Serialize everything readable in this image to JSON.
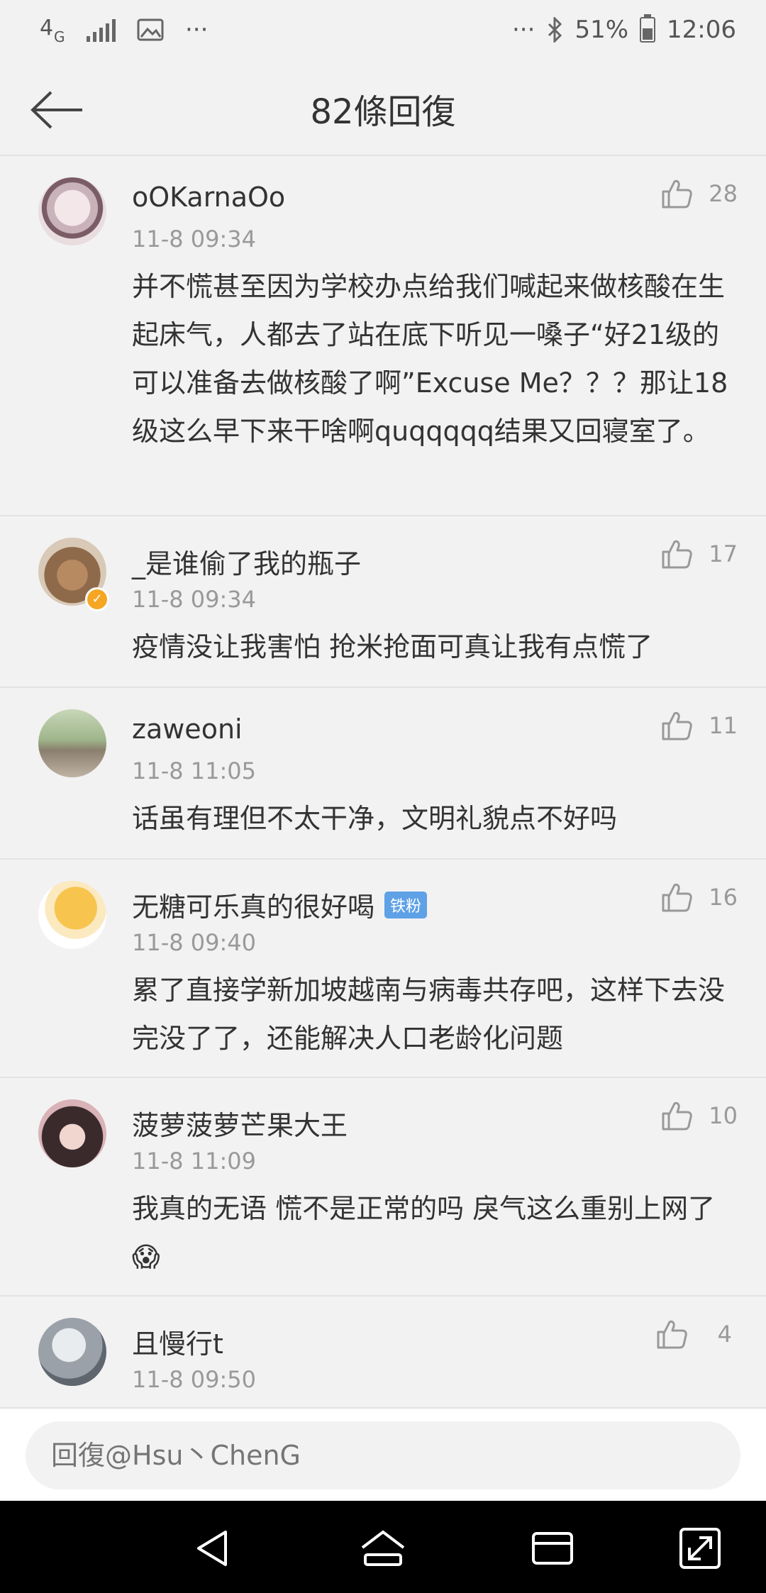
{
  "status_bar": {
    "network": "4G",
    "dots": "···",
    "battery": "51%",
    "time": "12:06"
  },
  "header": {
    "title": "82條回復"
  },
  "comments": [
    {
      "username": "oOKarnaOo",
      "time": "11-8 09:34",
      "likes": "28",
      "text": "并不慌甚至因为学校办点给我们喊起来做核酸在生起床气，人都去了站在底下听见一嗓子“好21级的可以准备去做核酸了啊”Excuse Me？？？那让18级这么早下来干啥啊quqqqqq结果又回寝室了。"
    },
    {
      "username": "_是谁偷了我的瓶子",
      "time": "11-8 09:34",
      "likes": "17",
      "verified": true,
      "text": "疫情没让我害怕 抢米抢面可真让我有点慌了"
    },
    {
      "username": "zaweoni",
      "time": "11-8 11:05",
      "likes": "11",
      "text": "话虽有理但不太干净，文明礼貌点不好吗"
    },
    {
      "username": "无糖可乐真的很好喝",
      "badge": "铁粉",
      "time": "11-8 09:40",
      "likes": "16",
      "text": "累了直接学新加坡越南与病毒共存吧，这样下去没完没了了，还能解决人口老龄化问题"
    },
    {
      "username": "菠萝菠萝芒果大王",
      "time": "11-8 11:09",
      "likes": "10",
      "text": "我真的无语 慌不是正常的吗 戾气这么重别上网了😱"
    },
    {
      "username": "且慢行t",
      "time": "11-8 09:50",
      "likes": "4",
      "text": ""
    }
  ],
  "reply": {
    "placeholder": "回復@Hsu丶ChenG"
  }
}
